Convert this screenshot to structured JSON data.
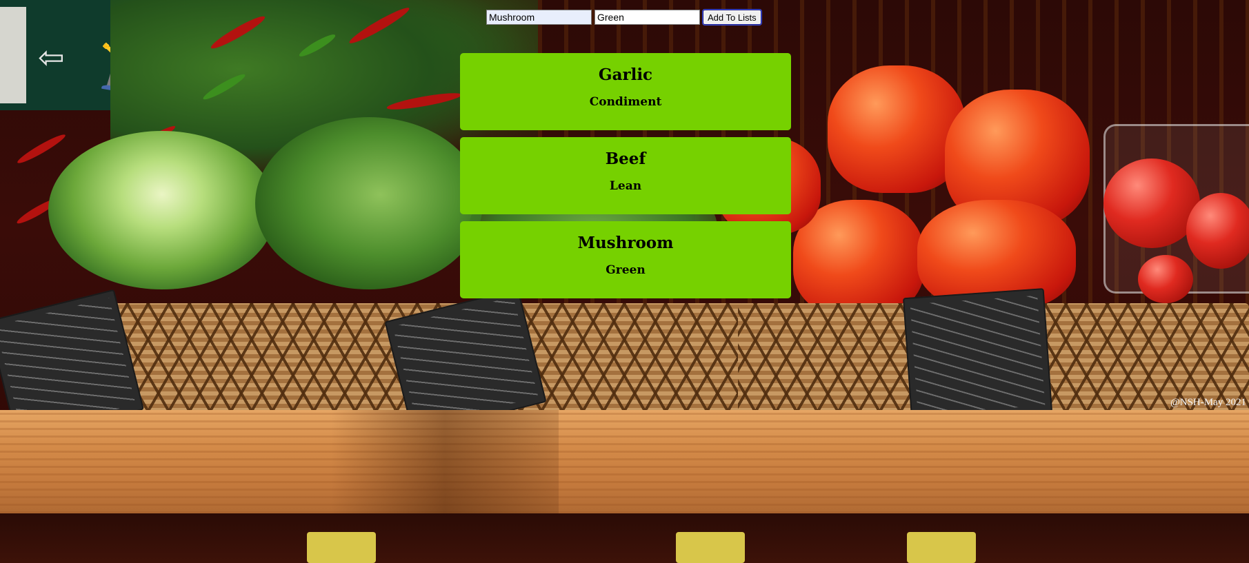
{
  "form": {
    "item_value": "Mushroom",
    "type_value": "Green",
    "submit_label": "Add To Lists"
  },
  "items": [
    {
      "name": "Garlic",
      "kind": "Condiment"
    },
    {
      "name": "Beef",
      "kind": "Lean"
    },
    {
      "name": "Mushroom",
      "kind": "Green"
    }
  ],
  "watermark": "@NSH-May 2021",
  "colors": {
    "card_background": "#76d100",
    "card_text": "#000000"
  }
}
